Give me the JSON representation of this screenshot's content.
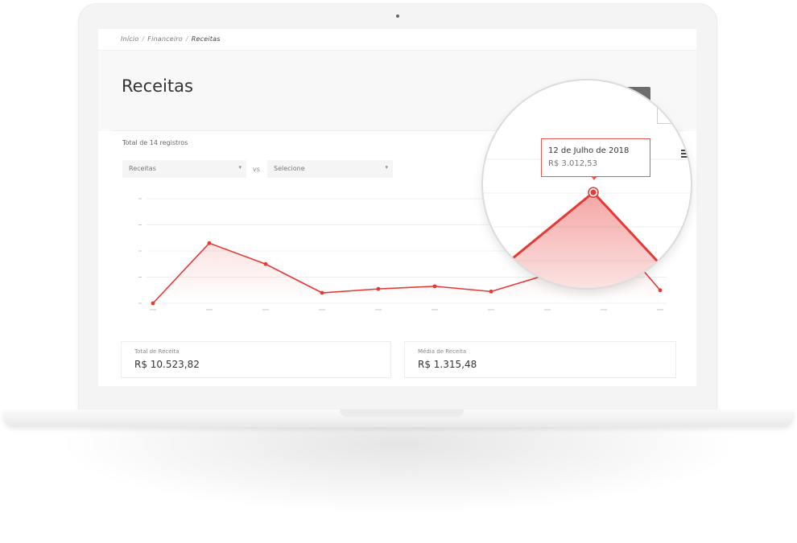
{
  "breadcrumb": [
    "Início",
    "Financeiro",
    "Receitas"
  ],
  "page": {
    "title": "Receitas"
  },
  "filters": {
    "records_count": "Total de 14 registros",
    "select_a": "Receitas",
    "vs": "vs",
    "select_b": "Selecione"
  },
  "summary": [
    {
      "label": "Total de Receita",
      "value": "R$ 10.523,82"
    },
    {
      "label": "Média de Receita",
      "value": "R$ 1.315,48"
    }
  ],
  "tooltip": {
    "date": "12 de Julho de 2018",
    "value": "R$ 3.012,53"
  },
  "colors": {
    "accent": "#e53935",
    "area": "#ffcdd2"
  },
  "icons": [
    "export-icon",
    "menu-icon",
    "chevron-down-icon"
  ],
  "chart_data": {
    "type": "line",
    "series": [
      {
        "values": [
          0,
          2300,
          1500,
          400,
          550,
          650,
          450,
          1100,
          3012.53,
          500
        ]
      }
    ],
    "ylim": [
      0,
      4000
    ],
    "grid": true
  }
}
